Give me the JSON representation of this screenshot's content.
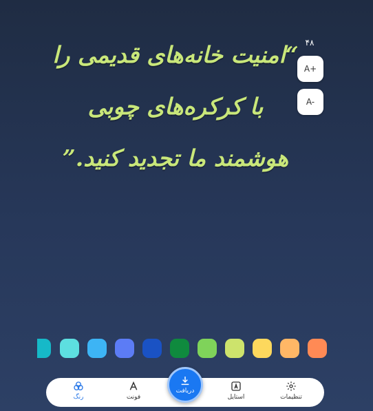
{
  "quote": {
    "text": "“امنیت خانه‌های قدیمی را با کرکره‌های چوبی هوشمند ما تجدید کنید.”"
  },
  "font_size": {
    "value": "۴۸",
    "increase_label": "A+",
    "decrease_label": "A-"
  },
  "palette": {
    "colors": [
      "#16b9c8",
      "#5ddfe0",
      "#3db4f5",
      "#5c7cf5",
      "#1a52c4",
      "#0f8a3e",
      "#7fd35a",
      "#cde36c",
      "#fdd85d",
      "#ffb766",
      "#ff8a55"
    ]
  },
  "bottom_nav": {
    "settings_label": "تنظیمات",
    "style_label": "استایل",
    "download_label": "دریافت",
    "font_label": "فونت",
    "color_label": "رنگ"
  },
  "colors": {
    "accent": "#1a78f2",
    "quote_text": "#c9e77a"
  }
}
